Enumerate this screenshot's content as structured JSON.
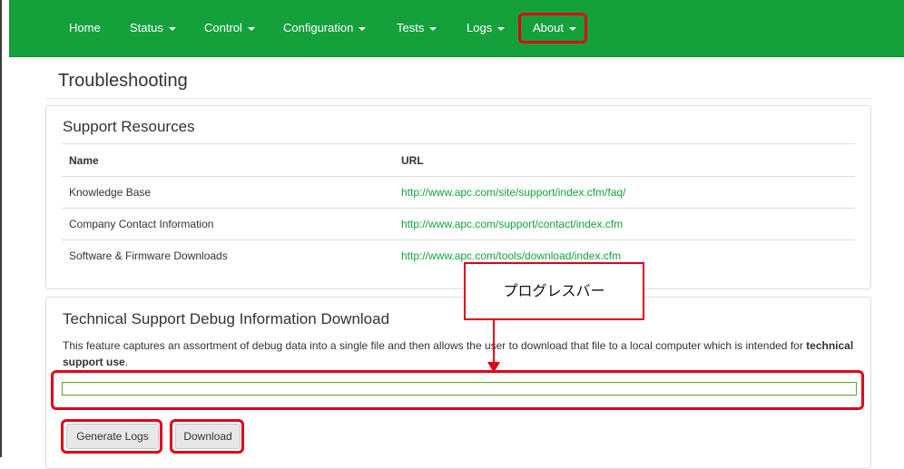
{
  "nav": {
    "items": [
      {
        "label": "Home",
        "caret": false
      },
      {
        "label": "Status",
        "caret": true
      },
      {
        "label": "Control",
        "caret": true
      },
      {
        "label": "Configuration",
        "caret": true
      },
      {
        "label": "Tests",
        "caret": true
      },
      {
        "label": "Logs",
        "caret": true
      },
      {
        "label": "About",
        "caret": true
      }
    ]
  },
  "page": {
    "title": "Troubleshooting"
  },
  "support_resources": {
    "title": "Support Resources",
    "columns": [
      "Name",
      "URL"
    ],
    "rows": [
      {
        "name": "Knowledge Base",
        "url": "http://www.apc.com/site/support/index.cfm/faq/"
      },
      {
        "name": "Company Contact Information",
        "url": "http://www.apc.com/support/contact/index.cfm"
      },
      {
        "name": "Software & Firmware Downloads",
        "url": "http://www.apc.com/tools/download/index.cfm"
      }
    ]
  },
  "debug": {
    "title": "Technical Support Debug Information Download",
    "description_pre": "This feature captures an assortment of debug data into a single file and then allows the user to download that file to a local computer which is intended for ",
    "description_bold": "technical support use",
    "description_post": ".",
    "progress_fraction": 0,
    "buttons": {
      "generate": "Generate Logs",
      "download": "Download"
    }
  },
  "annotation": {
    "callout": "プログレスバー"
  },
  "colors": {
    "brand_green": "#14a13c",
    "highlight_red": "#e0001a",
    "link_green": "#14a13c"
  }
}
